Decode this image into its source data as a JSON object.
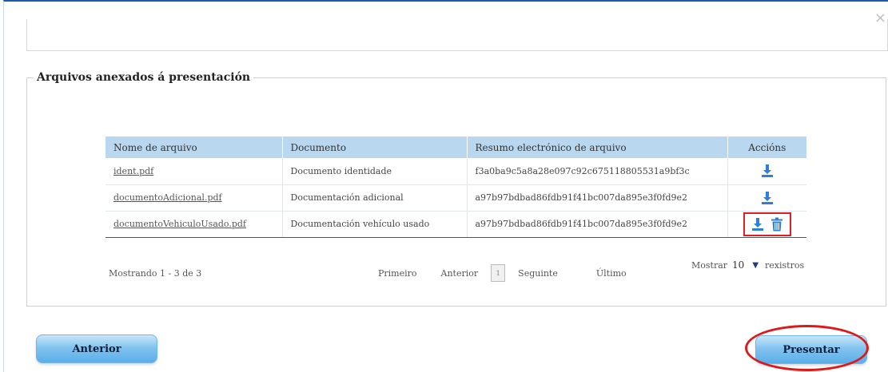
{
  "modal": {
    "close_label": "×"
  },
  "section": {
    "legend": "Arquivos anexados á presentación"
  },
  "table": {
    "columns": [
      "Nome de arquivo",
      "Documento",
      "Resumo electrónico de arquivo",
      "Accións"
    ],
    "rows": [
      {
        "file": "ident.pdf",
        "document": "Documento identidade",
        "hash": "f3a0ba9c5a8a28e097c92c675118805531a9bf3c",
        "actions": [
          "download-icon"
        ]
      },
      {
        "file": "documentoAdicional.pdf",
        "document": "Documentación adicional",
        "hash": "a97b97bdbad86fdb91f41bc007da895e3f0fd9e2",
        "actions": [
          "download-icon"
        ]
      },
      {
        "file": "documentoVehiculoUsado.pdf",
        "document": "Documentación vehículo usado",
        "hash": "a97b97bdbad86fdb91f41bc007da895e3f0fd9e2",
        "actions": [
          "download-icon",
          "trash-icon"
        ],
        "highlighted": true
      }
    ]
  },
  "pagination": {
    "showing": "Mostrando 1 - 3 de 3",
    "first": "Primeiro",
    "previous": "Anterior",
    "current_page": "1",
    "next": "Seguinte",
    "last": "Último",
    "show_label": "Mostrar",
    "page_size": "10",
    "records_label": "rexistros"
  },
  "buttons": {
    "previous": "Anterior",
    "submit": "Presentar"
  },
  "colors": {
    "header_bg": "#b9d8f0",
    "icon_blue": "#2e7fd6",
    "highlight_red": "#e02020",
    "button_blue": "#82c3ef"
  }
}
